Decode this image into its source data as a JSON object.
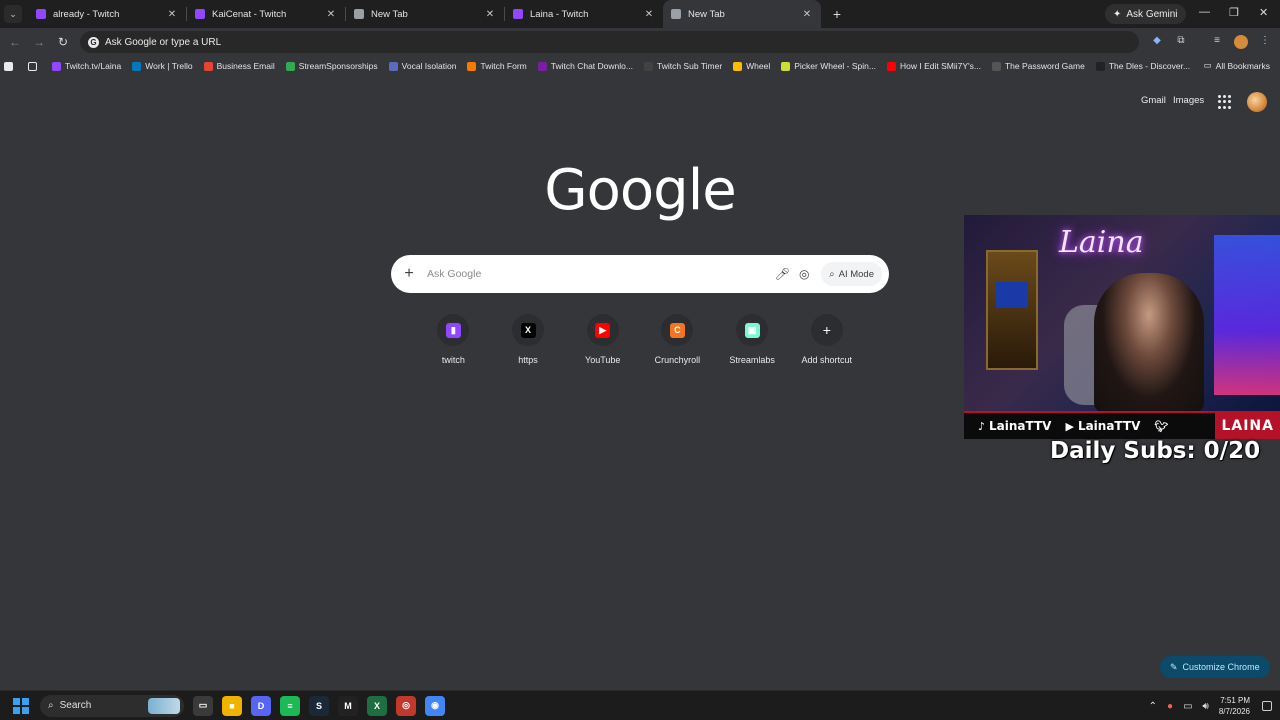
{
  "tabs": [
    {
      "title": "already - Twitch",
      "color": "#9146ff"
    },
    {
      "title": "KaiCenat - Twitch",
      "color": "#9146ff"
    },
    {
      "title": "New Tab",
      "color": "#9aa0a6"
    },
    {
      "title": "Laina - Twitch",
      "color": "#9146ff"
    },
    {
      "title": "New Tab",
      "color": "#9aa0a6",
      "active": true
    }
  ],
  "gemini_label": "Ask Gemini",
  "omnibox_placeholder": "Ask Google or type a URL",
  "bookmarks": [
    {
      "label": "Twitch.tv/Laina",
      "color": "#9146ff"
    },
    {
      "label": "Work | Trello",
      "color": "#0079bf"
    },
    {
      "label": "Business Email",
      "color": "#ea4335"
    },
    {
      "label": "StreamSponsorships",
      "color": "#34a853"
    },
    {
      "label": "Vocal Isolation",
      "color": "#5c6bc0"
    },
    {
      "label": "Twitch Form",
      "color": "#f57c00"
    },
    {
      "label": "Twitch Chat Downlo...",
      "color": "#7b1fa2"
    },
    {
      "label": "Twitch Sub Timer",
      "color": "#424242"
    },
    {
      "label": "Wheel",
      "color": "#fbbc04"
    },
    {
      "label": "Picker Wheel - Spin...",
      "color": "#cddc39"
    },
    {
      "label": "How I Edit SMii7Y's...",
      "color": "#ff0000"
    },
    {
      "label": "The Password Game",
      "color": "#555555"
    },
    {
      "label": "The Dles - Discover...",
      "color": "#222222"
    }
  ],
  "all_bookmarks": "All Bookmarks",
  "google": {
    "gmail": "Gmail",
    "images": "Images",
    "logo": "Google",
    "search_placeholder": "Ask Google",
    "ai_mode": "AI Mode"
  },
  "shortcuts": [
    {
      "label": "twitch",
      "icon": "twitch-icon",
      "color": "#9146ff",
      "glyph": "▮"
    },
    {
      "label": "https",
      "icon": "x-icon",
      "color": "#000000",
      "glyph": "X"
    },
    {
      "label": "YouTube",
      "icon": "youtube-icon",
      "color": "#ff0000",
      "glyph": "▶"
    },
    {
      "label": "Crunchyroll",
      "icon": "crunchyroll-icon",
      "color": "#f47521",
      "glyph": "C"
    },
    {
      "label": "Streamlabs",
      "icon": "streamlabs-icon",
      "color": "#80f5d2",
      "glyph": "▣"
    },
    {
      "label": "Add shortcut",
      "icon": "plus-icon",
      "color": "transparent",
      "glyph": "+"
    }
  ],
  "overlay": {
    "neon_sign": "Laina",
    "ticker": [
      {
        "icon": "tiktok-icon",
        "glyph": "♪",
        "label": "LainaTTV"
      },
      {
        "icon": "youtube-icon",
        "glyph": "▶",
        "label": "LainaTTV"
      }
    ],
    "brand": "LAINA",
    "daily_subs": "Daily Subs: 0/20"
  },
  "customize_label": "Customize Chrome",
  "taskbar": {
    "search_label": "Search",
    "apps": [
      {
        "name": "file-explorer-icon",
        "color": "#f0b400",
        "glyph": "■"
      },
      {
        "name": "discord-icon",
        "color": "#5865f2",
        "glyph": "D"
      },
      {
        "name": "spotify-icon",
        "color": "#1db954",
        "glyph": "≡"
      },
      {
        "name": "steam-icon",
        "color": "#1b2838",
        "glyph": "S"
      },
      {
        "name": "capcut-icon",
        "color": "#222222",
        "glyph": "M"
      },
      {
        "name": "excel-icon",
        "color": "#1d6f42",
        "glyph": "X"
      },
      {
        "name": "app-icon",
        "color": "#c0392b",
        "glyph": "◎"
      },
      {
        "name": "chrome-icon",
        "color": "#4285f4",
        "glyph": "◉"
      }
    ],
    "time": "7:51 PM",
    "date": "8/7/2026"
  }
}
